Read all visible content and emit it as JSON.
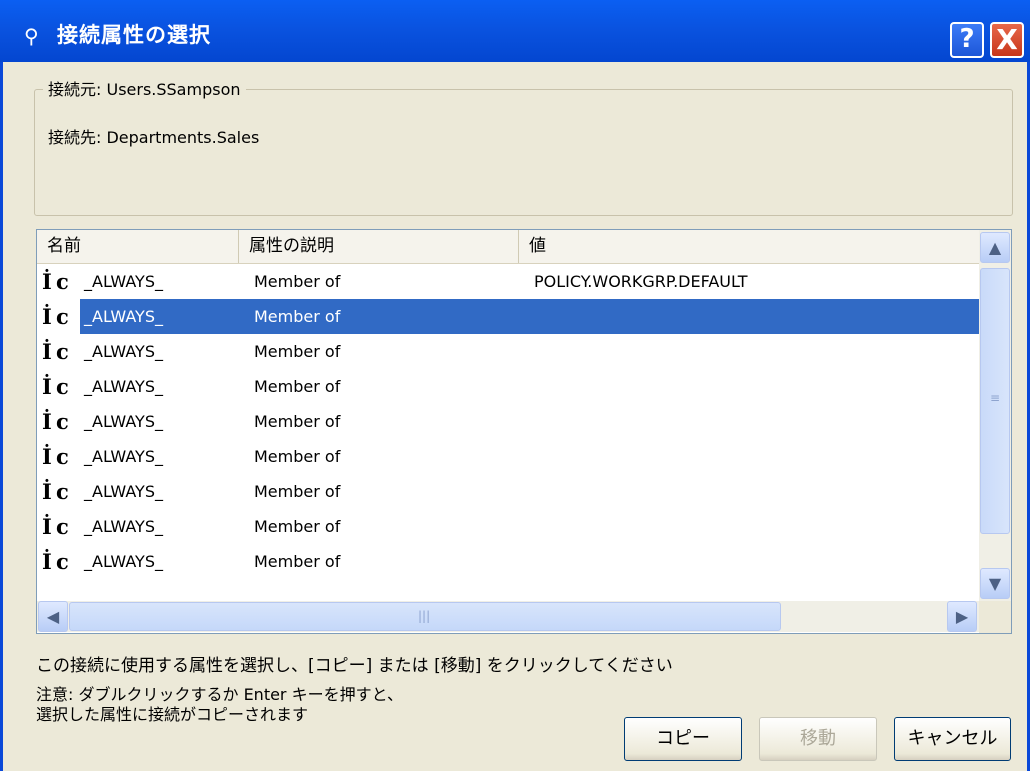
{
  "window": {
    "title": "接続属性の選択",
    "help_label": "?",
    "close_label": "X"
  },
  "connection": {
    "source": "接続元: Users.SSampson",
    "destination": "接続先: Departments.Sales"
  },
  "list": {
    "columns": [
      "名前",
      "属性の説明",
      "値"
    ],
    "rows": [
      {
        "icon": "attribute-icon",
        "name": "_ALWAYS_",
        "description": "Member of",
        "value": "POLICY.WORKGRP.DEFAULT",
        "selected": false
      },
      {
        "icon": "attribute-icon",
        "name": "_ALWAYS_",
        "description": "Member of",
        "value": "",
        "selected": true
      },
      {
        "icon": "attribute-icon",
        "name": "_ALWAYS_",
        "description": "Member of",
        "value": "",
        "selected": false
      },
      {
        "icon": "attribute-icon",
        "name": "_ALWAYS_",
        "description": "Member of",
        "value": "",
        "selected": false
      },
      {
        "icon": "attribute-icon",
        "name": "_ALWAYS_",
        "description": "Member of",
        "value": "",
        "selected": false
      },
      {
        "icon": "attribute-icon",
        "name": "_ALWAYS_",
        "description": "Member of",
        "value": "",
        "selected": false
      },
      {
        "icon": "attribute-icon",
        "name": "_ALWAYS_",
        "description": "Member of",
        "value": "",
        "selected": false
      },
      {
        "icon": "attribute-icon",
        "name": "_ALWAYS_",
        "description": "Member of",
        "value": "",
        "selected": false
      },
      {
        "icon": "attribute-icon",
        "name": "_ALWAYS_",
        "description": "Member of",
        "value": "",
        "selected": false
      }
    ]
  },
  "instructions": "この接続に使用する属性を選択し、[コピー] または [移動] をクリックしてください",
  "note_line1": "注意: ダブルクリックするか Enter キーを押すと、",
  "note_line2": "選択した属性に接続がコピーされます",
  "buttons": {
    "copy": "コピー",
    "move": "移動",
    "cancel": "キャンセル"
  },
  "colors": {
    "titlebar": "#0a53e0",
    "selection": "#316ac5",
    "dialog_bg": "#ece9d8"
  }
}
